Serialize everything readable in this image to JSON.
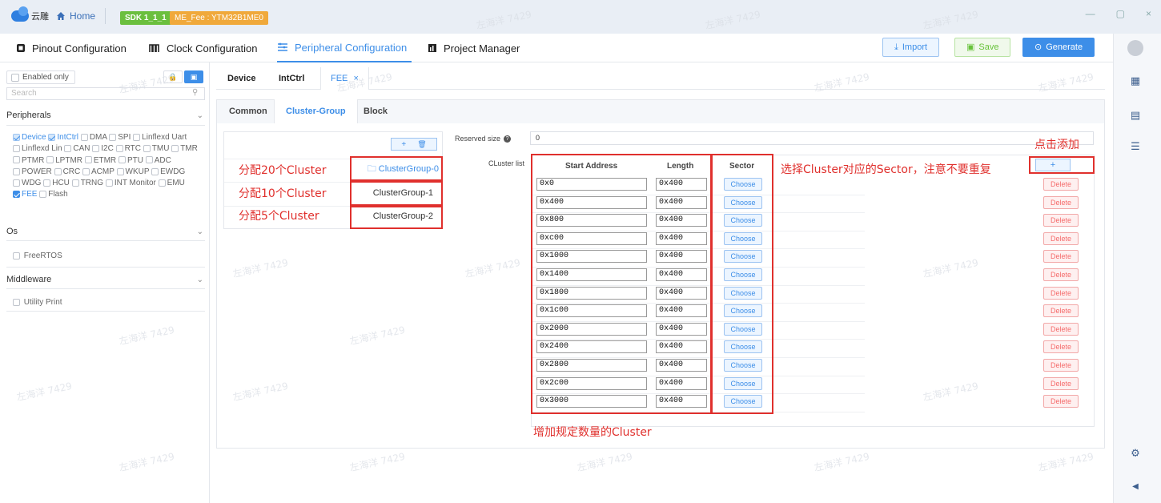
{
  "titlebar": {
    "logo_text": "云雕",
    "home_label": "Home",
    "sdk_badge": "SDK 1_1_1",
    "project_badge": "ME_Fee : YTM32B1ME0",
    "minimize": "—",
    "maximize": "▢",
    "close": "×"
  },
  "menu": {
    "pinout": "Pinout Configuration",
    "clock": "Clock Configuration",
    "peripheral": "Peripheral Configuration",
    "project": "Project Manager",
    "import": "Import",
    "save": "Save",
    "generate": "Generate"
  },
  "sidebar": {
    "enabled_only": "Enabled only",
    "search_placeholder": "Search",
    "sections": {
      "peripherals": "Peripherals",
      "os": "Os",
      "middleware": "Middleware"
    },
    "peripherals": [
      {
        "label": "Device",
        "checked": true,
        "selected": true
      },
      {
        "label": "IntCtrl",
        "checked": true,
        "selected": true
      },
      {
        "label": "DMA",
        "checked": false
      },
      {
        "label": "SPI",
        "checked": false
      },
      {
        "label": "Linflexd Uart",
        "checked": false
      },
      {
        "label": "Linflexd Lin",
        "checked": false
      },
      {
        "label": "CAN",
        "checked": false
      },
      {
        "label": "I2C",
        "checked": false
      },
      {
        "label": "RTC",
        "checked": false
      },
      {
        "label": "TMU",
        "checked": false
      },
      {
        "label": "TMR",
        "checked": false
      },
      {
        "label": "PTMR",
        "checked": false
      },
      {
        "label": "LPTMR",
        "checked": false
      },
      {
        "label": "ETMR",
        "checked": false
      },
      {
        "label": "PTU",
        "checked": false
      },
      {
        "label": "ADC",
        "checked": false
      },
      {
        "label": "POWER",
        "checked": false
      },
      {
        "label": "CRC",
        "checked": false
      },
      {
        "label": "ACMP",
        "checked": false
      },
      {
        "label": "WKUP",
        "checked": false
      },
      {
        "label": "EWDG",
        "checked": false
      },
      {
        "label": "WDG",
        "checked": false
      },
      {
        "label": "HCU",
        "checked": false
      },
      {
        "label": "TRNG",
        "checked": false
      },
      {
        "label": "INT Monitor",
        "checked": false
      },
      {
        "label": "EMU",
        "checked": false
      },
      {
        "label": "FEE",
        "checked": true,
        "selected": true
      },
      {
        "label": "Flash",
        "checked": false
      }
    ],
    "os_items": [
      "FreeRTOS"
    ],
    "middleware_items": [
      "Utility Print"
    ]
  },
  "tabs": {
    "device": "Device",
    "intctrl": "IntCtrl",
    "fee": "FEE",
    "fee_close": "×"
  },
  "subtabs": {
    "common": "Common",
    "cluster_group": "Cluster-Group",
    "block": "Block"
  },
  "groups": {
    "add": "+",
    "delete": "🗑",
    "items": [
      "ClusterGroup-0",
      "ClusterGroup-1",
      "ClusterGroup-2"
    ]
  },
  "annotations": {
    "group0": "分配20个Cluster",
    "group1": "分配10个Cluster",
    "group2": "分配5个Cluster",
    "sector": "选择Cluster对应的Sector，注意不要重复",
    "add": "点击添加",
    "increase": "增加规定数量的Cluster"
  },
  "cluster": {
    "reserved_label": "Reserved size",
    "reserved_value": "0",
    "list_label": "CLuster list",
    "col_start": "Start Address",
    "col_length": "Length",
    "col_sector": "Sector",
    "add_label": "+",
    "choose_label": "Choose",
    "delete_label": "Delete",
    "rows": [
      {
        "start": "0x0",
        "length": "0x400"
      },
      {
        "start": "0x400",
        "length": "0x400"
      },
      {
        "start": "0x800",
        "length": "0x400"
      },
      {
        "start": "0xc00",
        "length": "0x400"
      },
      {
        "start": "0x1000",
        "length": "0x400"
      },
      {
        "start": "0x1400",
        "length": "0x400"
      },
      {
        "start": "0x1800",
        "length": "0x400"
      },
      {
        "start": "0x1c00",
        "length": "0x400"
      },
      {
        "start": "0x2000",
        "length": "0x400"
      },
      {
        "start": "0x2400",
        "length": "0x400"
      },
      {
        "start": "0x2800",
        "length": "0x400"
      },
      {
        "start": "0x2c00",
        "length": "0x400"
      },
      {
        "start": "0x3000",
        "length": "0x400"
      }
    ]
  },
  "watermark": "左海洋 7429",
  "colors": {
    "accent": "#3d8ee8",
    "annotation_red": "#e0302d",
    "save_green": "#67c23a",
    "delete_red": "#f56c6c"
  }
}
